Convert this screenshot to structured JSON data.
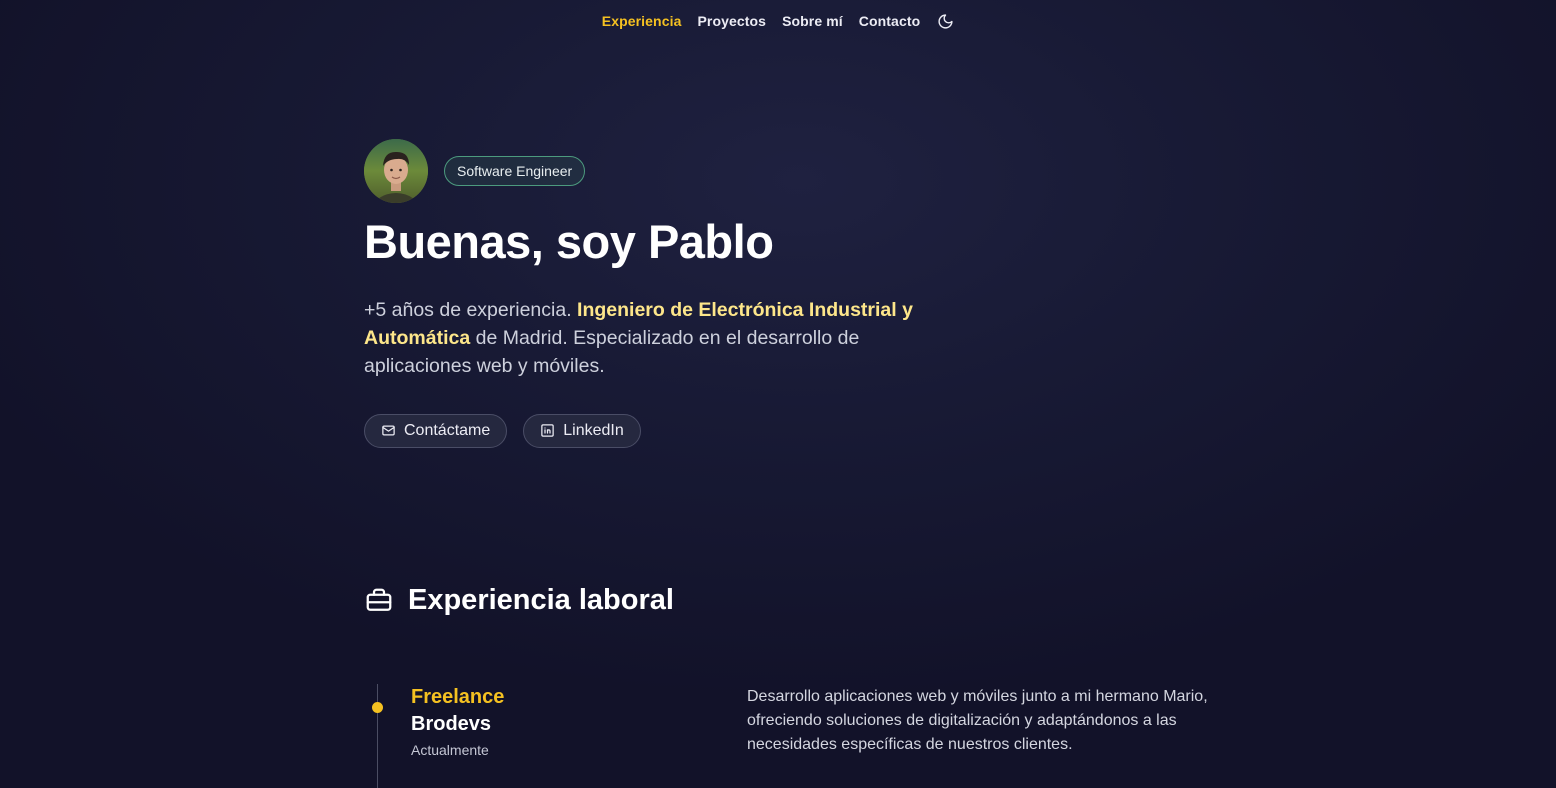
{
  "nav": {
    "items": [
      {
        "label": "Experiencia",
        "active": true
      },
      {
        "label": "Proyectos",
        "active": false
      },
      {
        "label": "Sobre mí",
        "active": false
      },
      {
        "label": "Contacto",
        "active": false
      }
    ],
    "theme_icon": "moon-icon"
  },
  "hero": {
    "badge": "Software Engineer",
    "title": "Buenas, soy Pablo",
    "intro": {
      "part1": "+5 años de experiencia. ",
      "highlight": "Ingeniero de Electrónica Industrial y Automática",
      "part2": " de Madrid. Especializado en el desarrollo de aplicaciones web y móviles."
    },
    "buttons": {
      "contact_label": "Contáctame",
      "contact_icon": "mail-icon",
      "linkedin_label": "LinkedIn",
      "linkedin_icon": "linkedin-icon"
    }
  },
  "experience": {
    "title": "Experiencia laboral",
    "icon": "briefcase-icon",
    "jobs": [
      {
        "role": "Freelance",
        "company": "Brodevs",
        "when": "Actualmente",
        "description": "Desarrollo aplicaciones web y móviles junto a mi hermano Mario, ofreciendo soluciones de digitalización y adaptándonos a las necesidades específicas de nuestros clientes."
      }
    ]
  },
  "colors": {
    "accent": "#f5c121",
    "highlight": "#fde68a",
    "background": "#181a35",
    "badge_border": "#4c9b7e"
  }
}
